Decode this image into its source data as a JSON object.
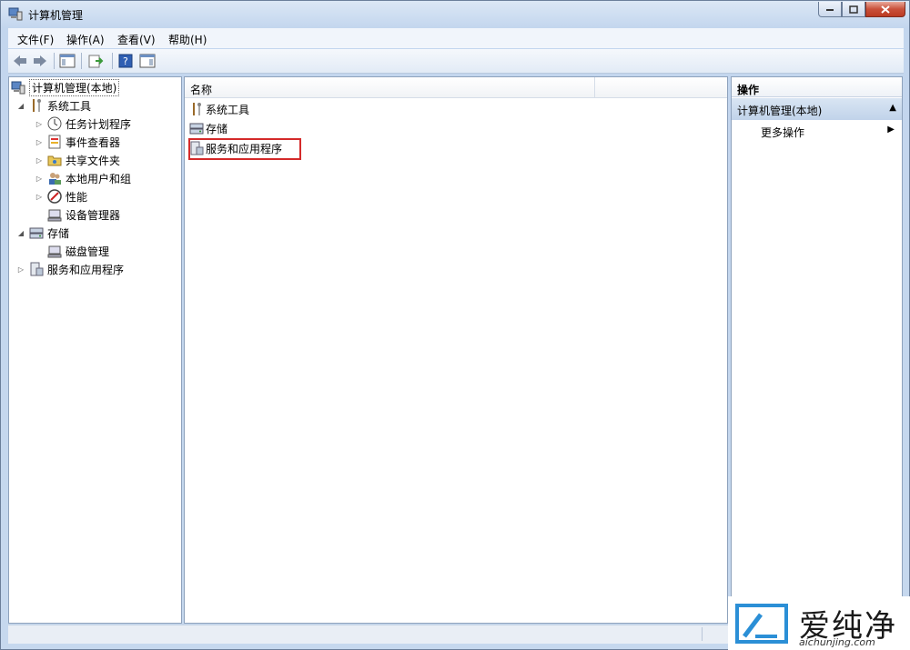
{
  "window": {
    "title": "计算机管理"
  },
  "menu": [
    "文件(F)",
    "操作(A)",
    "查看(V)",
    "帮助(H)"
  ],
  "toolbar": {
    "icons": [
      "back-arrow-icon",
      "forward-arrow-icon",
      "show-hide-console-tree-icon",
      "export-list-icon",
      "help-icon",
      "show-hide-action-pane-icon"
    ]
  },
  "tree": {
    "root": "计算机管理(本地)",
    "system_tools": "系统工具",
    "task_scheduler": "任务计划程序",
    "event_viewer": "事件查看器",
    "shared_folders": "共享文件夹",
    "local_users": "本地用户和组",
    "performance": "性能",
    "device_manager": "设备管理器",
    "storage": "存储",
    "disk_management": "磁盘管理",
    "services_apps": "服务和应用程序"
  },
  "list": {
    "column_name": "名称",
    "items": [
      "系统工具",
      "存储",
      "服务和应用程序"
    ],
    "highlight_color": "#d42a2a"
  },
  "actions": {
    "header": "操作",
    "group": "计算机管理(本地)",
    "more": "更多操作"
  },
  "watermark": {
    "cn": "爱纯净",
    "en": "aichunjing.com"
  }
}
